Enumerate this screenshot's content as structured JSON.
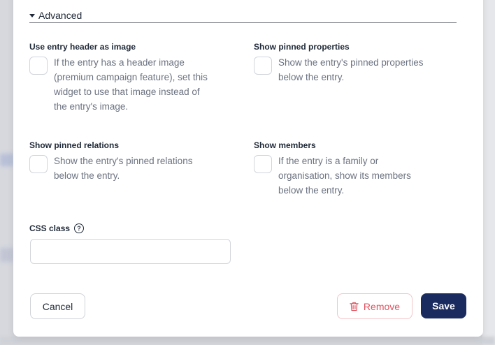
{
  "section": {
    "title": "Advanced"
  },
  "fields": {
    "header_image": {
      "label": "Use entry header as image",
      "help_lines": [
        "If the entry has a header image",
        "(premium campaign feature), set this",
        "widget to use that image instead of",
        "the entry's image."
      ]
    },
    "pinned_properties": {
      "label": "Show pinned properties",
      "help_lines": [
        "Show the entry's pinned properties",
        "below the entry."
      ]
    },
    "pinned_relations": {
      "label": "Show pinned relations",
      "help_lines": [
        "Show the entry's pinned relations",
        "below the entry."
      ]
    },
    "members": {
      "label": "Show members",
      "help_lines": [
        "If the entry is a family or",
        "organisation, show its members",
        "below the entry."
      ]
    },
    "css_class": {
      "label": "CSS class",
      "help_icon": "question-circle-icon",
      "value": "",
      "placeholder": ""
    }
  },
  "buttons": {
    "cancel": "Cancel",
    "remove": "Remove",
    "save": "Save"
  },
  "icons": {
    "section_toggle": "caret-down-icon",
    "remove": "trash-icon"
  },
  "colors": {
    "primary": "#1a2b5f",
    "danger": "#e0525f",
    "text": "#1f2937",
    "muted": "#6b7280"
  }
}
